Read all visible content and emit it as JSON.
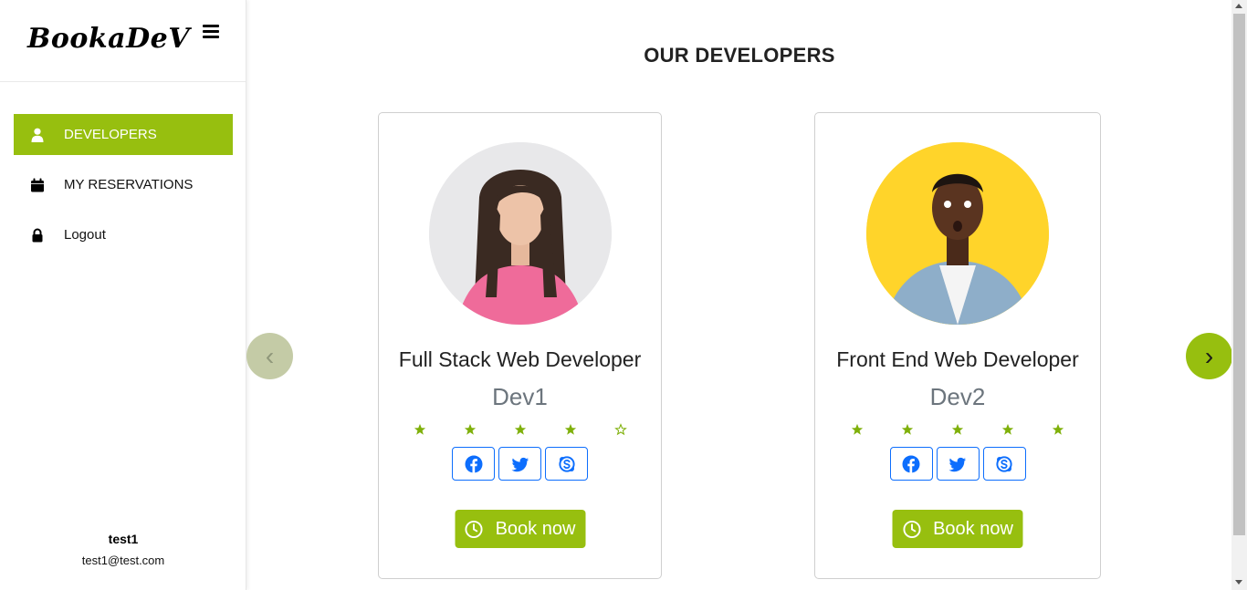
{
  "brand": {
    "logo_text": "BookaDeV"
  },
  "sidebar": {
    "items": [
      {
        "label": "DEVELOPERS",
        "icon": "user-icon",
        "active": true
      },
      {
        "label": "MY RESERVATIONS",
        "icon": "calendar-icon",
        "active": false
      },
      {
        "label": "Logout",
        "icon": "lock-icon",
        "active": false
      }
    ]
  },
  "user": {
    "name": "test1",
    "email": "test1@test.com"
  },
  "main": {
    "title": "OUR DEVELOPERS",
    "developers": [
      {
        "role": "Full Stack Web Developer",
        "name": "Dev1",
        "rating": 4,
        "max_rating": 5,
        "book_label": "Book now"
      },
      {
        "role": "Front End Web Developer",
        "name": "Dev2",
        "rating": 5,
        "max_rating": 5,
        "book_label": "Book now"
      }
    ],
    "prev_arrow": "‹",
    "next_arrow": "›"
  },
  "colors": {
    "accent": "#97bf0f",
    "link_blue": "#0d6efd",
    "muted": "#6c757d"
  }
}
